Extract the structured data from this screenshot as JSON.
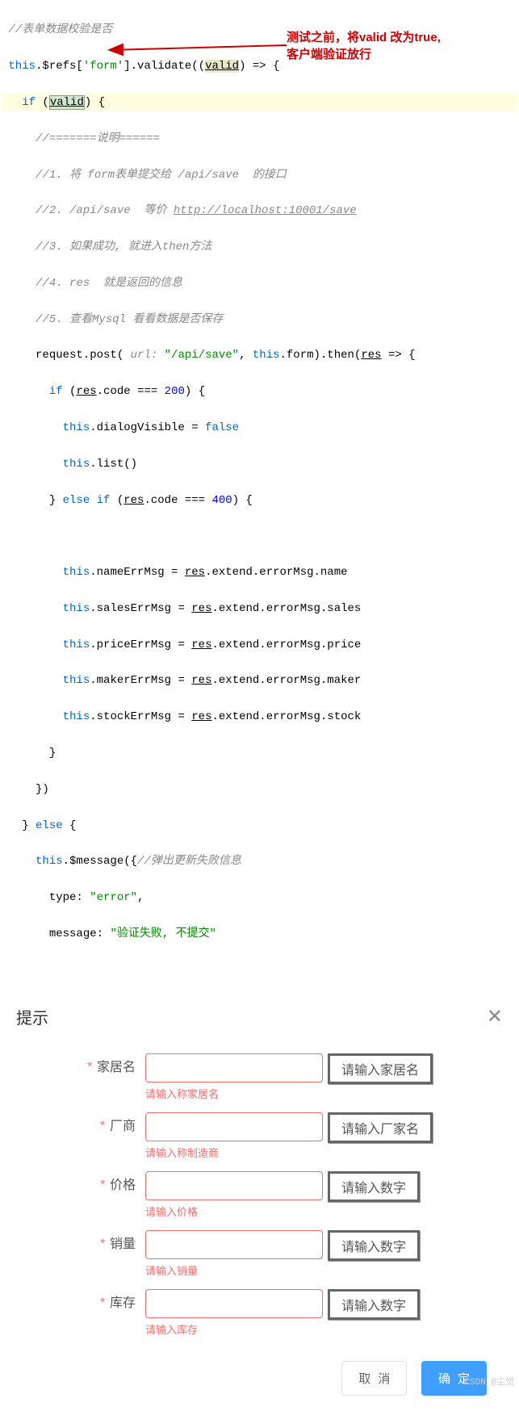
{
  "code": {
    "c1": "//表单数据校验是否",
    "l2a": "this",
    "l2b": ".$refs[",
    "l2c": "'form'",
    "l2d": "].validate((",
    "l2e": "valid",
    "l2f": ") => {",
    "l3a": "if",
    "l3b": " (",
    "l3c": "valid",
    "l3d": ") {",
    "c4": "//=======说明======",
    "c5": "//1. 将 form表单提交给 /api/save  的接口",
    "c6a": "//2. /api/save  等价 ",
    "c6b": "http://localhost:10001/save",
    "c7": "//3. 如果成功, 就进入then方法",
    "c8": "//4. res  就是返回的信息",
    "c9": "//5. 查看Mysql 看看数据是否保存",
    "l10a": "request.post(",
    "l10b": " url: ",
    "l10c": "\"/api/save\"",
    "l10d": ", ",
    "l10e": "this",
    "l10f": ".form).then(",
    "l10g": "res",
    "l10h": " => {",
    "l11a": "if",
    "l11b": " (",
    "l11c": "res",
    "l11d": ".code === ",
    "l11e": "200",
    "l11f": ") {",
    "l12a": "this",
    "l12b": ".dialogVisible = ",
    "l12c": "false",
    "l13a": "this",
    "l13b": ".list()",
    "l14": "} ",
    "l14b": "else if",
    "l14c": " (",
    "l14d": "res",
    "l14e": ".code === ",
    "l14f": "400",
    "l14g": ") {",
    "l16a": "this",
    "l16b": ".nameErrMsg = ",
    "l16c": "res",
    "l16d": ".extend.errorMsg.name",
    "l17a": "this",
    "l17b": ".salesErrMsg = ",
    "l17c": "res",
    "l17d": ".extend.errorMsg.sales",
    "l18a": "this",
    "l18b": ".priceErrMsg = ",
    "l18c": "res",
    "l18d": ".extend.errorMsg.price",
    "l19a": "this",
    "l19b": ".makerErrMsg = ",
    "l19c": "res",
    "l19d": ".extend.errorMsg.maker",
    "l20a": "this",
    "l20b": ".stockErrMsg = ",
    "l20c": "res",
    "l20d": ".extend.errorMsg.stock",
    "l21": "}",
    "l22": "})",
    "l23a": "} ",
    "l23b": "else",
    "l23c": " {",
    "l24a": "this",
    "l24b": ".$message({",
    "c24": "//弹出更新失败信息",
    "l25a": "type: ",
    "l25b": "\"error\"",
    "l25c": ",",
    "l26a": "message: ",
    "l26b": "\"验证失败, 不提交\""
  },
  "annotation": {
    "line1": "测试之前，将valid 改为true,",
    "line2": "客户端验证放行"
  },
  "dialog": {
    "title": "提示",
    "fields": [
      {
        "label": "家居名",
        "hint": "请输入家居名",
        "error": "请输入称家居名"
      },
      {
        "label": "厂商",
        "hint": "请输入厂家名",
        "error": "请输入称制造商"
      },
      {
        "label": "价格",
        "hint": "请输入数字",
        "error": "请输入价格"
      },
      {
        "label": "销量",
        "hint": "请输入数字",
        "error": "请输入销量"
      },
      {
        "label": "库存",
        "hint": "请输入数字",
        "error": "请输入库存"
      }
    ],
    "cancel": "取 消",
    "confirm": "确 定"
  },
  "watermark": "CSDN @尘觉"
}
